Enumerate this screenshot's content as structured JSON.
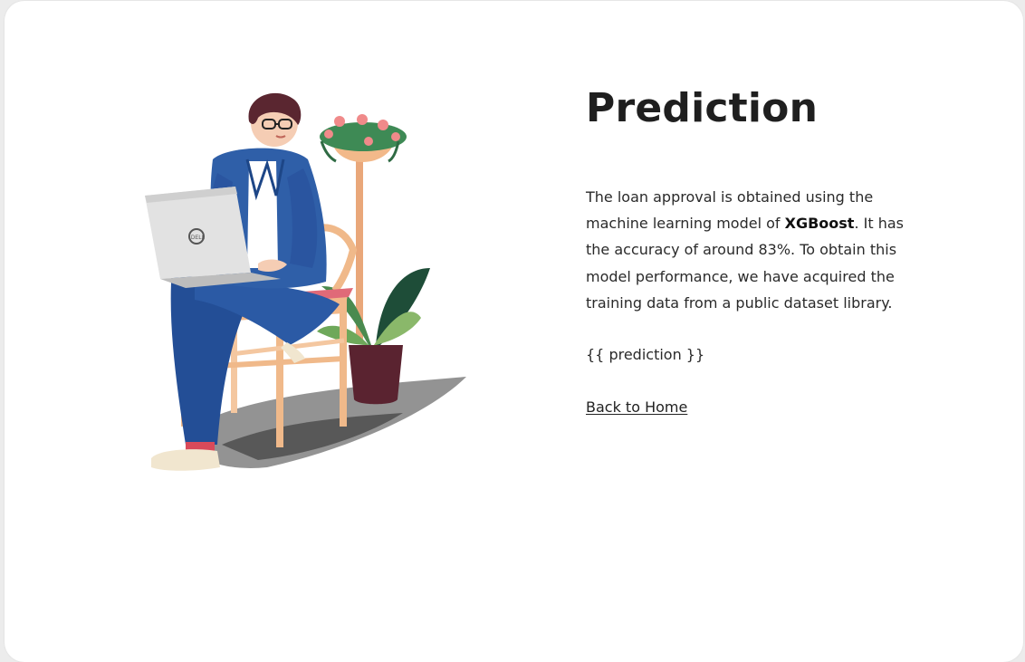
{
  "page": {
    "title": "Prediction",
    "description_before": "The loan approval is obtained using the machine learning model of ",
    "model_name": "XGBoost",
    "description_after": ". It has the accuracy of around 83%. To obtain this model performance, we have acquired the training data from a public dataset library.",
    "prediction_placeholder": "{{ prediction }}",
    "back_link": "Back to Home"
  },
  "colors": {
    "background": "#ffffff",
    "text": "#1f1f1f",
    "jacket": "#2f5fa8",
    "chair": "#f0b98a",
    "plant": "#2e6b4a"
  },
  "illustration": {
    "icon": "person-with-laptop-illustration"
  }
}
